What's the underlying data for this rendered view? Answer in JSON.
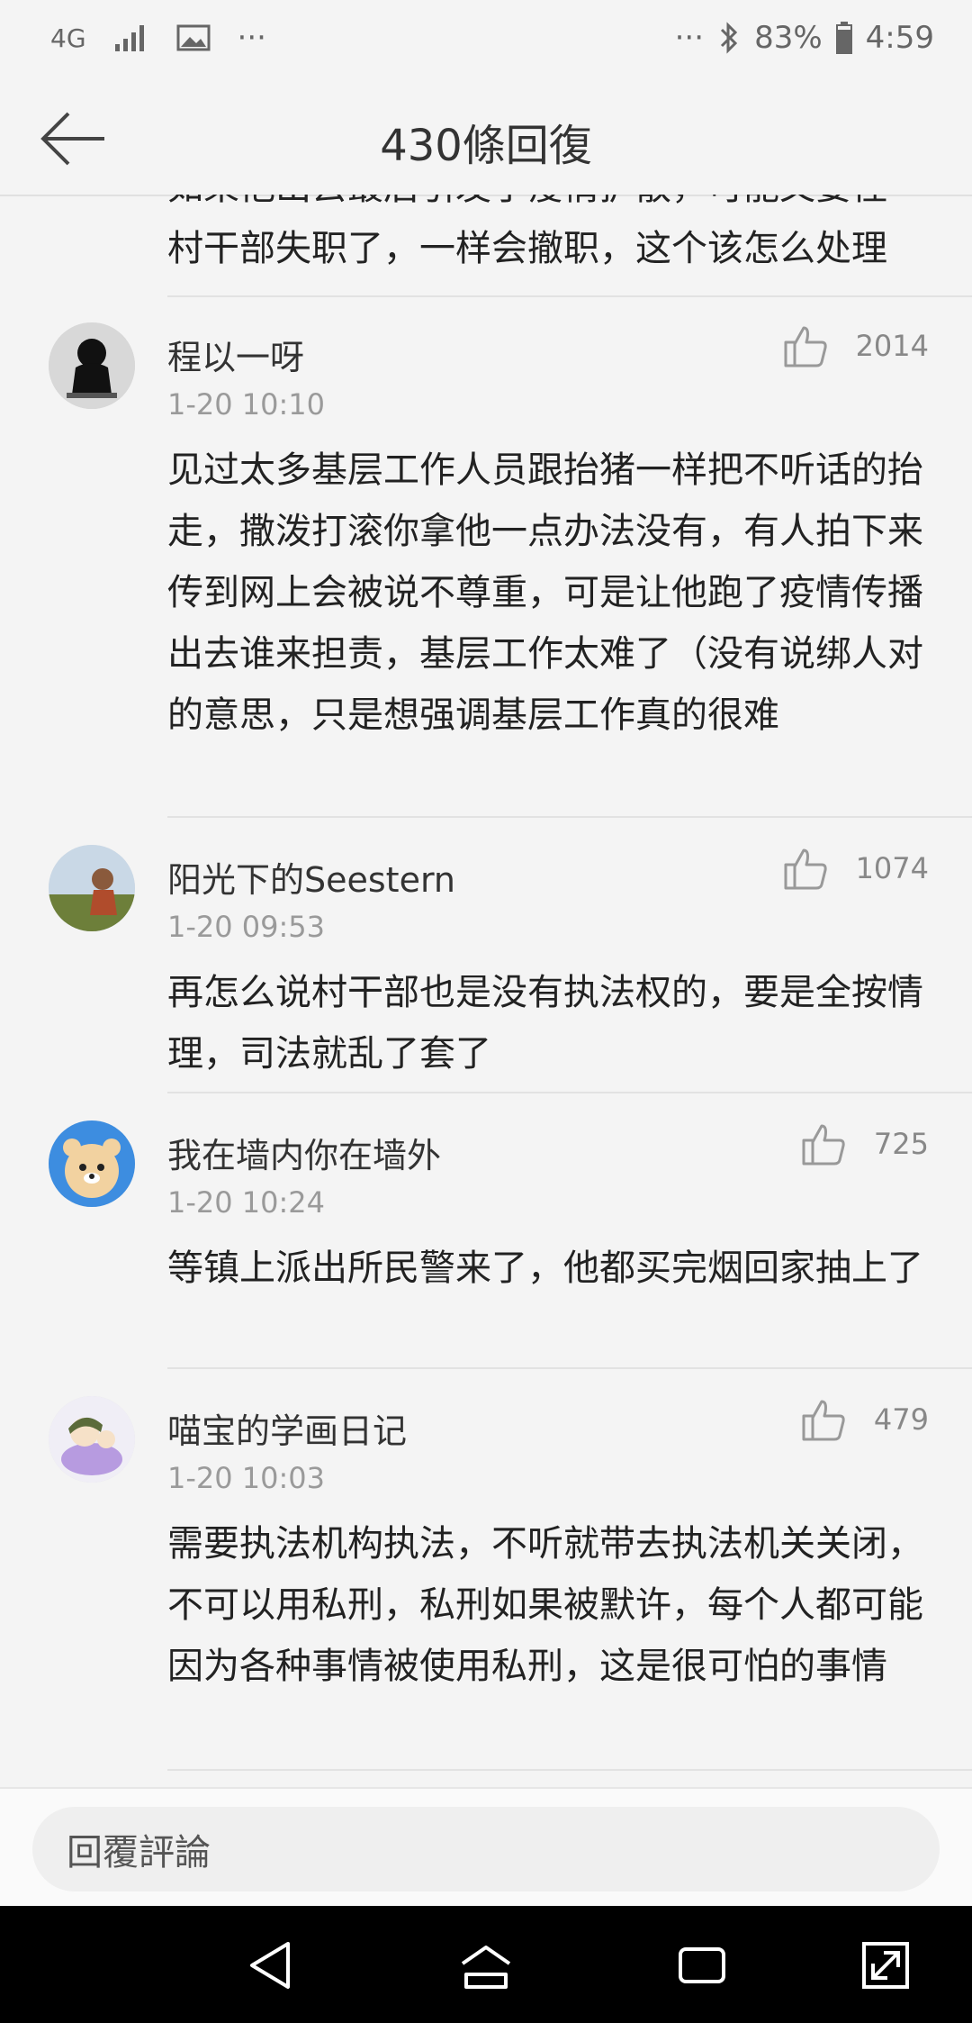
{
  "status_bar": {
    "network": "4G",
    "more_left": "···",
    "more_right": "···",
    "battery": "83%",
    "time": "4:59"
  },
  "header": {
    "title": "430條回復"
  },
  "partial_comment": {
    "line1": "如果他出去最后引发了疫情扩散，可能又要怪",
    "line2": "村干部失职了，一样会撤职，这个该怎么处理"
  },
  "comments": [
    {
      "username": "程以一呀",
      "time": "1-20 10:10",
      "likes": "2014",
      "avatar_icon": "avatar-black-figure-icon",
      "text": "见过太多基层工作人员跟抬猪一样把不听话的抬走，撒泼打滚你拿他一点办法没有，有人拍下来传到网上会被说不尊重，可是让他跑了疫情传播出去谁来担责，基层工作太难了（没有说绑人对的意思，只是想强调基层工作真的很难"
    },
    {
      "username": "阳光下的Seestern",
      "time": "1-20 09:53",
      "likes": "1074",
      "avatar_icon": "avatar-photo-icon",
      "text": "再怎么说村干部也是没有执法权的，要是全按情理，司法就乱了套了"
    },
    {
      "username": "我在墙内你在墙外",
      "time": "1-20 10:24",
      "likes": "725",
      "avatar_icon": "avatar-bear-icon",
      "text": "等镇上派出所民警来了，他都买完烟回家抽上了"
    },
    {
      "username": "喵宝的学画日记",
      "time": "1-20 10:03",
      "likes": "479",
      "avatar_icon": "avatar-drawing-icon",
      "text": "需要执法机构执法，不听就带去执法机关关闭，不可以用私刑，私刑如果被默许，每个人都可能因为各种事情被使用私刑，这是很可怕的事情"
    }
  ],
  "reply": {
    "placeholder": "回覆評論"
  },
  "colors": {
    "background": "#f4f4f4",
    "text": "#222222",
    "meta": "#9a9a9a",
    "nav": "#000000"
  }
}
